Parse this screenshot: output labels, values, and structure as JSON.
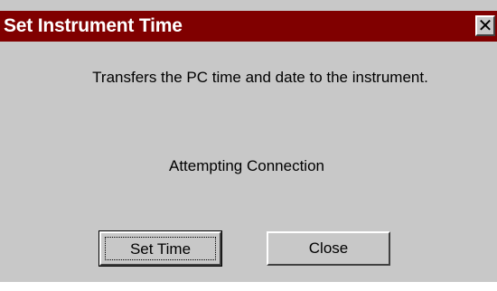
{
  "window": {
    "title": "Set Instrument Time",
    "close_glyph": "✕",
    "close_icon": "close-icon"
  },
  "content": {
    "description": "Transfers the PC time and date to the instrument.",
    "status": "Attempting Connection"
  },
  "buttons": {
    "set_time_label": "Set Time",
    "close_label": "Close"
  },
  "colors": {
    "titlebar": "#800000",
    "dialog_background": "#c8c8c8"
  }
}
